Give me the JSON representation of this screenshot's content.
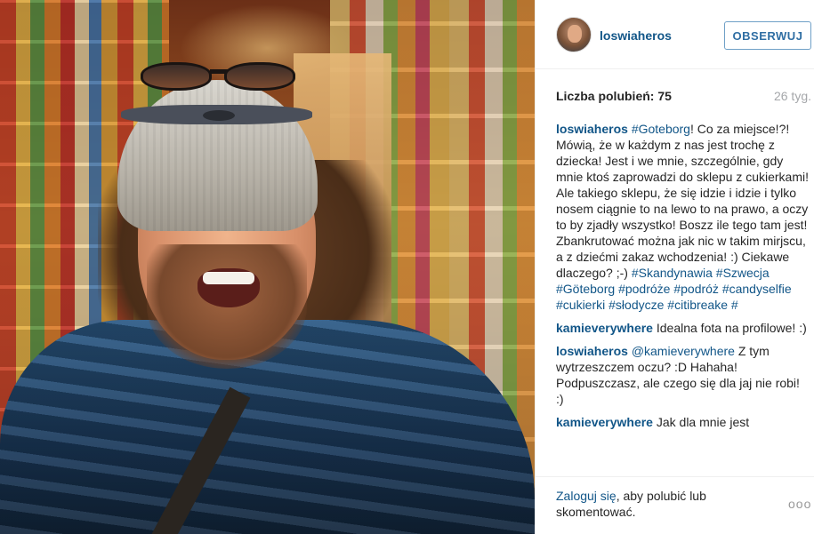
{
  "header": {
    "username": "loswiaheros",
    "follow_label": "OBSERWUJ"
  },
  "stats": {
    "likes": "Liczba polubień: 75",
    "age": "26 tyg."
  },
  "caption": {
    "user": "loswiaheros",
    "tag1": "#Goteborg",
    "text1": "! Co za miejsce!?! Mówią, że w każdym z nas jest trochę z dziecka! Jest i we mnie, szczególnie, gdy mnie ktoś zaprowadzi do sklepu z cukierkami! Ale takiego sklepu, że się idzie i idzie i tylko nosem ciągnie to na lewo to na prawo, a oczy to by zjadły wszystko! Boszz ile tego tam jest! Zbankrutować można jak nic w takim mirjscu, a z dziećmi zakaz wchodzenia! :) Ciekawe dlaczego? ;-) ",
    "tags": [
      "#Skandynawia",
      "#Szwecja",
      "#Göteborg",
      "#podróże",
      "#podróż",
      "#candyselfie",
      "#cukierki",
      "#słodycze",
      "#citibreake",
      "#"
    ]
  },
  "comments": [
    {
      "user": "kamieverywhere",
      "mention": "",
      "text": "Idealna fota na profilowe! :)"
    },
    {
      "user": "loswiaheros",
      "mention": "@kamieverywhere",
      "text": " Z tym wytrzeszczem oczu? :D Hahaha! Podpuszczasz, ale czego się dla jaj nie robi! :)"
    },
    {
      "user": "kamieverywhere",
      "mention": "",
      "text": "Jak dla mnie jest"
    }
  ],
  "footer": {
    "login_link": "Zaloguj się",
    "login_text": ", aby polubić lub skomentować.",
    "more": "ooo"
  },
  "icons": {
    "avatar": "user-avatar",
    "more": "ellipsis-icon"
  },
  "colors": {
    "link": "#125688",
    "follow_border": "#6fa0c7",
    "muted": "#a5a7aa"
  }
}
